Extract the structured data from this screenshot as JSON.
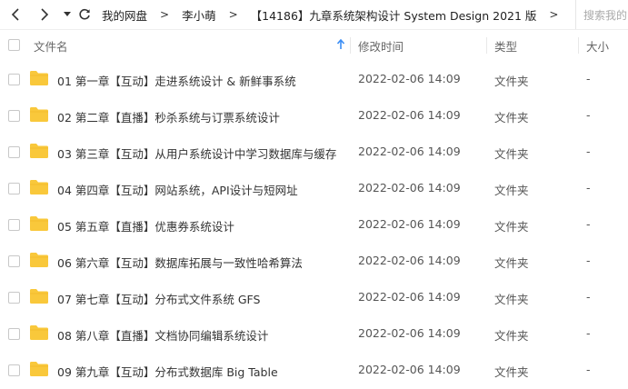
{
  "breadcrumb": {
    "items": [
      "我的网盘",
      "李小萌",
      "【14186】九章系统架构设计 System Design 2021 版"
    ],
    "separator": ">",
    "trailing_separator": ">"
  },
  "search": {
    "placeholder": "搜索我的"
  },
  "columns": {
    "name": "文件名",
    "modified": "修改时间",
    "type": "类型",
    "size": "大小"
  },
  "rows": [
    {
      "name": "01 第一章【互动】走进系统设计 & 新鲜事系统",
      "modified": "2022-02-06 14:09",
      "type": "文件夹",
      "size": "-"
    },
    {
      "name": "02 第二章【直播】秒杀系统与订票系统设计",
      "modified": "2022-02-06 14:09",
      "type": "文件夹",
      "size": "-"
    },
    {
      "name": "03 第三章【互动】从用户系统设计中学习数据库与缓存",
      "modified": "2022-02-06 14:09",
      "type": "文件夹",
      "size": "-"
    },
    {
      "name": "04 第四章【互动】网站系统，API设计与短网址",
      "modified": "2022-02-06 14:09",
      "type": "文件夹",
      "size": "-"
    },
    {
      "name": "05 第五章【直播】优惠券系统设计",
      "modified": "2022-02-06 14:09",
      "type": "文件夹",
      "size": "-"
    },
    {
      "name": "06 第六章【互动】数据库拓展与一致性哈希算法",
      "modified": "2022-02-06 14:09",
      "type": "文件夹",
      "size": "-"
    },
    {
      "name": "07 第七章【互动】分布式文件系统 GFS",
      "modified": "2022-02-06 14:09",
      "type": "文件夹",
      "size": "-"
    },
    {
      "name": "08 第八章【直播】文档协同编辑系统设计",
      "modified": "2022-02-06 14:09",
      "type": "文件夹",
      "size": "-"
    },
    {
      "name": "09 第九章【互动】分布式数据库 Big Table",
      "modified": "2022-02-06 14:09",
      "type": "文件夹",
      "size": "-"
    }
  ],
  "colors": {
    "folder": "#F9C83B",
    "sort_arrow": "#3A8DF5"
  },
  "icons": {
    "back": "chevron-left-icon",
    "forward": "chevron-right-icon",
    "history": "caret-down-icon",
    "refresh": "refresh-icon",
    "sort": "arrow-up-icon",
    "row": "folder-icon"
  }
}
